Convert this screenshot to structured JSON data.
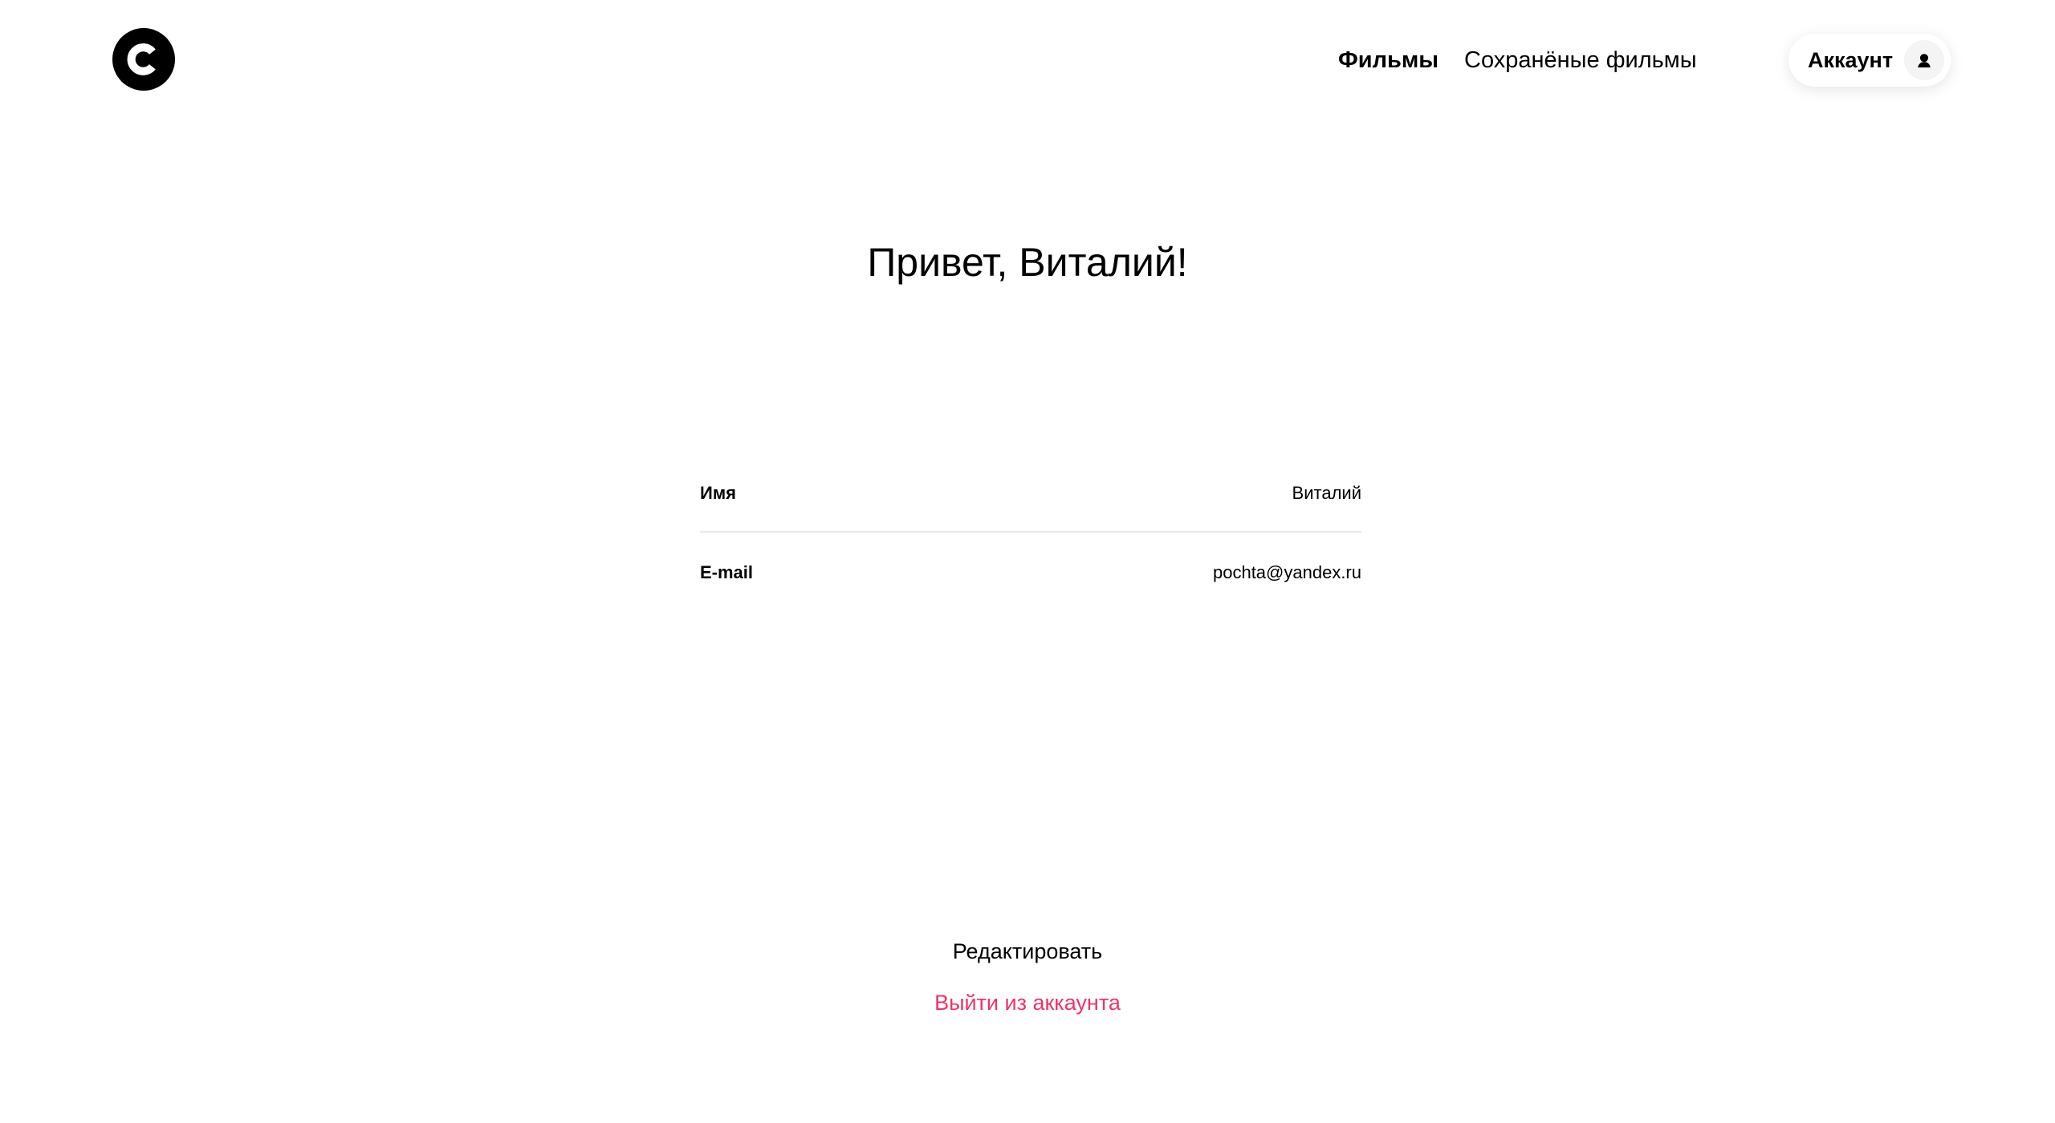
{
  "header": {
    "logo_icon": "c-circle-logo",
    "nav": {
      "films_label": "Фильмы",
      "saved_films_label": "Сохранёные фильмы"
    },
    "account": {
      "label": "Аккаунт",
      "icon": "user-icon"
    }
  },
  "main": {
    "greeting": "Привет, Виталий!",
    "profile": {
      "name_label": "Имя",
      "name_value": "Виталий",
      "email_label": "E-mail",
      "email_value": "pochta@yandex.ru"
    },
    "actions": {
      "edit_label": "Редактировать",
      "logout_label": "Выйти из аккаунта"
    }
  },
  "colors": {
    "text": "#000000",
    "background": "#ffffff",
    "logout_accent": "#ee3465",
    "divider": "#e8e8e8"
  }
}
